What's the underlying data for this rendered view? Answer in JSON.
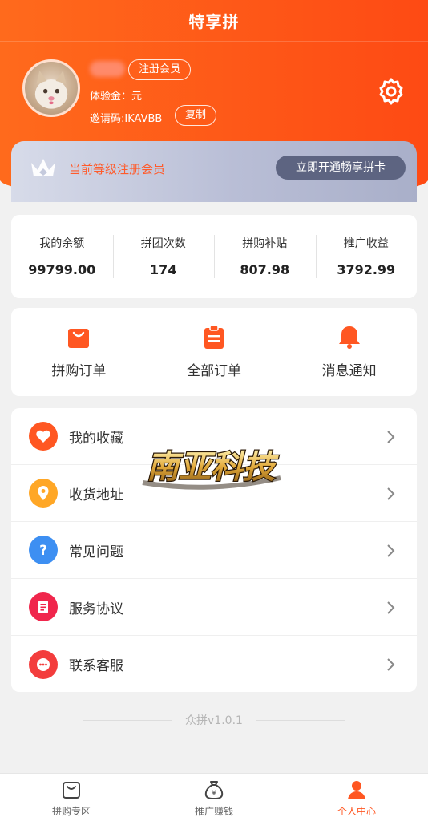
{
  "header": {
    "title": "特享拼"
  },
  "profile": {
    "member_tag": "注册会员",
    "balance_line": "体验金：元",
    "invite_line": "邀请码:IKAVBB",
    "copy_label": "复制"
  },
  "vip": {
    "level_text": "当前等级注册会员",
    "button_label": "立即开通畅享拼卡"
  },
  "stats": [
    {
      "label": "我的余额",
      "value": "99799.00"
    },
    {
      "label": "拼团次数",
      "value": "174"
    },
    {
      "label": "拼购补贴",
      "value": "807.98"
    },
    {
      "label": "推广收益",
      "value": "3792.99"
    }
  ],
  "orders": [
    {
      "label": "拼购订单",
      "icon": "shopping-bag-icon"
    },
    {
      "label": "全部订单",
      "icon": "clipboard-icon"
    },
    {
      "label": "消息通知",
      "icon": "bell-icon"
    }
  ],
  "menu": [
    {
      "label": "我的收藏",
      "icon": "heart-icon",
      "color": "#ff5722"
    },
    {
      "label": "收货地址",
      "icon": "location-icon",
      "color": "#ffa726"
    },
    {
      "label": "常见问题",
      "icon": "question-icon",
      "color": "#3d8ff2"
    },
    {
      "label": "服务协议",
      "icon": "document-icon",
      "color": "#f0264c"
    },
    {
      "label": "联系客服",
      "icon": "chat-icon",
      "color": "#f33d3d"
    }
  ],
  "watermark": "南亚科技",
  "version": "众拼v1.0.1",
  "tabbar": [
    {
      "label": "拼购专区",
      "icon": "cart-icon",
      "active": false
    },
    {
      "label": "推广赚钱",
      "icon": "money-bag-icon",
      "active": false
    },
    {
      "label": "个人中心",
      "icon": "person-icon",
      "active": true
    }
  ],
  "colors": {
    "brand": "#ff5722",
    "vip_button": "#5d6481"
  }
}
